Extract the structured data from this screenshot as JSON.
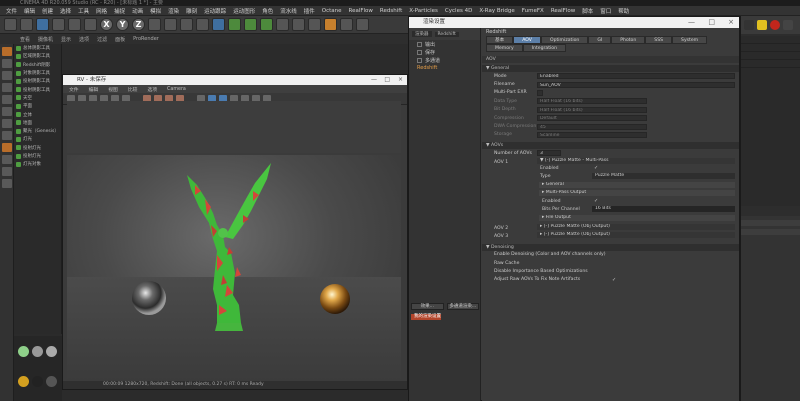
{
  "app": {
    "title": "CINEMA 4D R20.059 Studio (RC - R20) - [未标题 1 *] - 主要",
    "menu": [
      "文件",
      "编辑",
      "创建",
      "选择",
      "工具",
      "网格",
      "捕捉",
      "动画",
      "模拟",
      "渲染",
      "雕刻",
      "运动跟踪",
      "运动图形",
      "角色",
      "流水线",
      "插件",
      "Octane",
      "RealFlow",
      "Redshift",
      "X-Particles",
      "Cycles 4D",
      "X-Ray Bridge",
      "FumeFX",
      "RealFlow",
      "脚本",
      "窗口",
      "帮助"
    ],
    "toolbar_xyz": [
      "X",
      "Y",
      "Z"
    ],
    "toolbar2": [
      "查看",
      "摄像机",
      "显示",
      "选项",
      "过滤",
      "面板",
      "ProRender"
    ],
    "objects": [
      "总体阴影工具",
      "区域阴影工具",
      "Redshift阴影",
      "对象阴影工具",
      "投射阴影工具",
      "投射阴影工具",
      "天空",
      "平面",
      "立体",
      "地面",
      "聚光（Genesis）",
      "灯光",
      "投射灯光",
      "投射灯光",
      "灯光对象"
    ],
    "material_tab": [
      "材质",
      "编辑",
      "功能",
      "Cycles"
    ]
  },
  "render_view": {
    "title": "Redshift RV",
    "subtitle": "RV - 未保存",
    "menu": [
      "文件",
      "编辑",
      "视图",
      "比较",
      "选项",
      "Camera"
    ],
    "status": "00:00:09  1280x720, Redshift: Done (all objects, 0.27 s)  RT: 0 ms  Ready",
    "controls": [
      "—",
      "□",
      "×"
    ]
  },
  "render_settings": {
    "title": "渲染设置",
    "controls": [
      "—",
      "□",
      "×"
    ],
    "left_tabs": [
      "渲染器",
      "Redshift"
    ],
    "left_items": [
      {
        "label": "输出",
        "active": false
      },
      {
        "label": "保存",
        "active": false
      },
      {
        "label": "多通道",
        "active": false
      },
      {
        "label": "Redshift",
        "active": true
      }
    ],
    "left_buttons": [
      "效果...",
      "多通道渲染..."
    ],
    "left_selected": "我的渲染设置",
    "header": "Redshift",
    "tabs": [
      {
        "label": "基本",
        "active": false
      },
      {
        "label": "AOV",
        "active": true
      },
      {
        "label": "Optimization",
        "active": false
      },
      {
        "label": "GI",
        "active": false
      },
      {
        "label": "Photon",
        "active": false
      },
      {
        "label": "SSS",
        "active": false
      },
      {
        "label": "System",
        "active": false
      },
      {
        "label": "Memory",
        "active": false
      },
      {
        "label": "Integration",
        "active": false
      }
    ],
    "aov_label": "AOV",
    "general_section": "▼ General",
    "general": [
      {
        "label": "Mode",
        "value": "Enabled",
        "dim": false
      },
      {
        "label": "Filename",
        "value": "Sun_AOV",
        "dim": false
      },
      {
        "label": "Multi-Part EXR",
        "value": "",
        "dim": false
      },
      {
        "label": "Data Type",
        "value": "Half Float (16 bits)",
        "dim": true
      },
      {
        "label": "Bit Depth",
        "value": "Half Float (16 bits)",
        "dim": true
      },
      {
        "label": "Compression",
        "value": "Default",
        "dim": true
      },
      {
        "label": "DWA Compression",
        "value": "45",
        "dim": true
      },
      {
        "label": "Storage",
        "value": "Scanline",
        "dim": true
      }
    ],
    "aovs_section": "▼ AOVs",
    "num_aovs_label": "Number of AOVs",
    "num_aovs": "3",
    "aov1_label": "AOV 1",
    "aov1_header": "▼ [-] Puzzle Matte - Multi-Pass",
    "aov1_enabled_label": "Enabled",
    "aov1_type_label": "Type",
    "aov1_type": "Puzzle Matte",
    "aov1_sub": [
      "▸ General",
      "▸ Multi-Pass Output",
      "Enabled",
      "Bits Per Channel"
    ],
    "aov1_bits": "16 Bits",
    "aov1_sub2": "▸ File Output",
    "aov2_label": "AOV 2",
    "aov2_header": "▸ [-] Puzzle Matte (Obj Output)",
    "aov3_label": "AOV 3",
    "aov3_header": "▸ [-] Puzzle Matte (Obj Output)",
    "denoise_section": "▼ Denoising",
    "denoise": [
      {
        "label": "Enable Denoising (Color and AOV channels only)",
        "checked": false
      },
      {
        "label": "Raw Cache",
        "checked": false
      },
      {
        "label": "Disable Importance Based Optimizations",
        "checked": false
      },
      {
        "label": "Adjust Raw AOVs To Fix Note Artifacts",
        "checked": true
      }
    ]
  }
}
